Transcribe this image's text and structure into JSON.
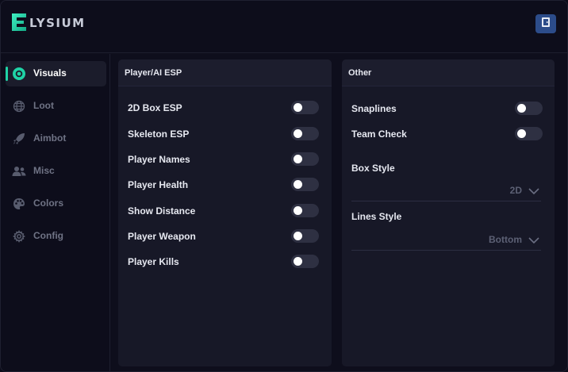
{
  "app": {
    "logo_text": "LYSIUM",
    "logo_mark_letter": "E",
    "accent_color": "#1fd3a6"
  },
  "header": {
    "exit_icon": "door-exit-icon"
  },
  "sidebar": {
    "items": [
      {
        "label": "Visuals",
        "icon": "target-ring-icon",
        "active": true
      },
      {
        "label": "Loot",
        "icon": "globe-icon",
        "active": false
      },
      {
        "label": "Aimbot",
        "icon": "rocket-icon",
        "active": false
      },
      {
        "label": "Misc",
        "icon": "users-icon",
        "active": false
      },
      {
        "label": "Colors",
        "icon": "palette-icon",
        "active": false
      },
      {
        "label": "Config",
        "icon": "gear-icon",
        "active": false
      }
    ]
  },
  "esp_panel": {
    "title": "Player/AI ESP",
    "toggles": [
      {
        "label": "2D Box ESP",
        "on": false
      },
      {
        "label": "Skeleton ESP",
        "on": false
      },
      {
        "label": "Player Names",
        "on": false
      },
      {
        "label": "Player Health",
        "on": false
      },
      {
        "label": "Show Distance",
        "on": false
      },
      {
        "label": "Player Weapon",
        "on": false
      },
      {
        "label": "Player Kills",
        "on": false
      }
    ]
  },
  "other_panel": {
    "title": "Other",
    "toggles": [
      {
        "label": "Snaplines",
        "on": false
      },
      {
        "label": "Team Check",
        "on": false
      }
    ],
    "dropdowns": [
      {
        "label": "Box Style",
        "value": "2D"
      },
      {
        "label": "Lines Style",
        "value": "Bottom"
      }
    ]
  }
}
